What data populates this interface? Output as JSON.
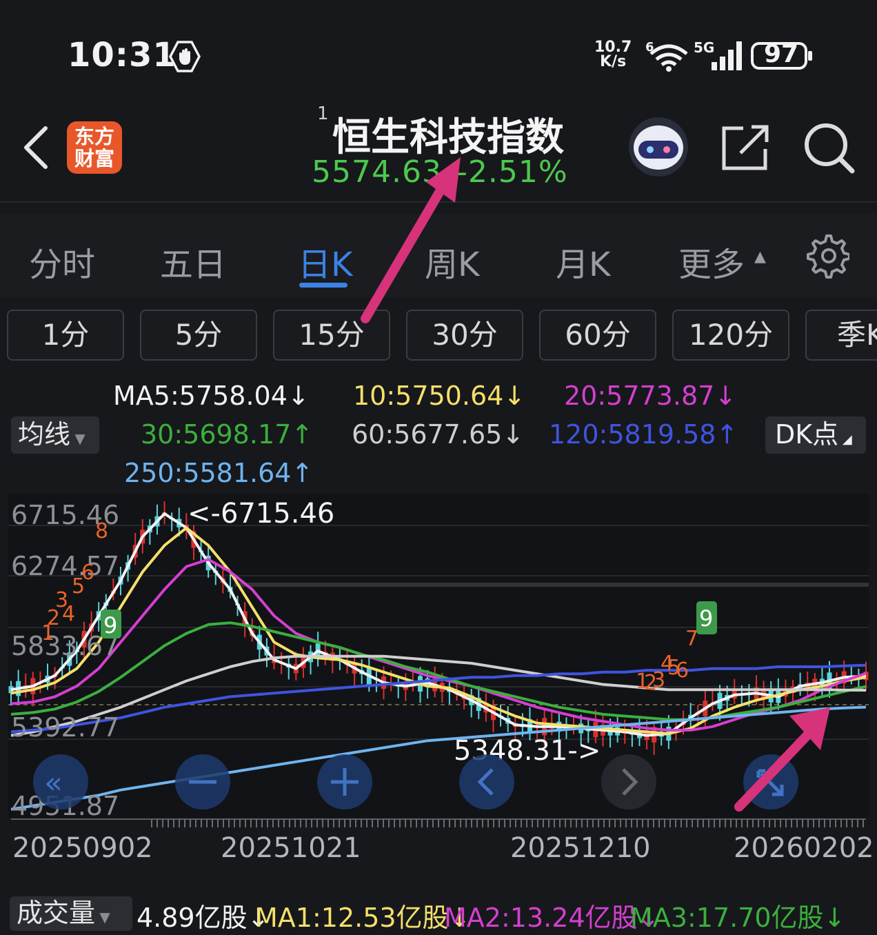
{
  "status_bar": {
    "time": "10:31",
    "net_speed_value": "10.7",
    "net_speed_unit": "K/s",
    "wifi_badge": "6",
    "signal_label": "5G",
    "battery": "97"
  },
  "header": {
    "logo_text_line1": "东方",
    "logo_text_line2": "财富",
    "title_sup": "1",
    "title": "恒生科技指数",
    "price": "5574.63",
    "change": "-2.51%"
  },
  "tabs": [
    {
      "label": "分时",
      "active": false
    },
    {
      "label": "五日",
      "active": false
    },
    {
      "label": "日K",
      "active": true
    },
    {
      "label": "周K",
      "active": false
    },
    {
      "label": "月K",
      "active": false
    },
    {
      "label": "更多",
      "active": false
    }
  ],
  "intervals": [
    "1分",
    "5分",
    "15分",
    "30分",
    "60分",
    "120分",
    "季K"
  ],
  "ma_select": "均线",
  "dk_button": "DK点",
  "ma_legend": [
    {
      "text": "MA5:5758.04↓",
      "color": "#f2f2f2"
    },
    {
      "text": "10:5750.64↓",
      "color": "#f5e06a"
    },
    {
      "text": "20:5773.87↓",
      "color": "#d43fd0"
    },
    {
      "text": "30:5698.17↑",
      "color": "#3bb03d"
    },
    {
      "text": "60:5677.65↓",
      "color": "#cfcfcf"
    },
    {
      "text": "120:5819.58↑",
      "color": "#3f54e0"
    },
    {
      "text": "250:5581.64↑",
      "color": "#6fb4f0"
    }
  ],
  "chart_data": {
    "type": "candlestick",
    "y_ticks": [
      "6715.46",
      "6274.57",
      "5833.67",
      "5392.77",
      "4951.87"
    ],
    "ylim": [
      4951.87,
      6715.46
    ],
    "x_ticks": [
      "20250902",
      "20251021",
      "20251210",
      "20260202"
    ],
    "annotations": {
      "high": "<-6715.46",
      "low": "5348.31->"
    },
    "dk_marks_left": [
      "1",
      "2",
      "3",
      "4",
      "5",
      "6",
      "8"
    ],
    "dk_marks_right": [
      "1",
      "2",
      "3",
      "4",
      "5",
      "6",
      "7"
    ],
    "signal_badges": [
      "9",
      "9"
    ],
    "current_price": 5574.63,
    "series": [
      {
        "name": "MA5",
        "color": "#f2f2f2",
        "values": [
          5680,
          5700,
          5760,
          5900,
          6100,
          6300,
          6550,
          6680,
          6600,
          6400,
          6250,
          6000,
          5850,
          5800,
          5900,
          5850,
          5780,
          5720,
          5700,
          5720,
          5680,
          5620,
          5550,
          5480,
          5470,
          5470,
          5460,
          5450,
          5440,
          5420,
          5430,
          5520,
          5600,
          5650,
          5660,
          5640,
          5700,
          5720,
          5750,
          5758
        ]
      },
      {
        "name": "10",
        "color": "#f5e06a",
        "values": [
          5660,
          5680,
          5720,
          5800,
          5950,
          6150,
          6350,
          6500,
          6600,
          6500,
          6350,
          6150,
          5950,
          5880,
          5860,
          5850,
          5820,
          5780,
          5740,
          5700,
          5690,
          5640,
          5580,
          5530,
          5490,
          5480,
          5470,
          5460,
          5450,
          5440,
          5430,
          5460,
          5530,
          5580,
          5620,
          5650,
          5680,
          5700,
          5730,
          5750
        ]
      },
      {
        "name": "20",
        "color": "#d43fd0",
        "values": [
          5600,
          5610,
          5640,
          5700,
          5800,
          5950,
          6100,
          6250,
          6380,
          6420,
          6350,
          6250,
          6100,
          6000,
          5950,
          5920,
          5880,
          5840,
          5800,
          5760,
          5730,
          5700,
          5660,
          5620,
          5580,
          5550,
          5520,
          5500,
          5480,
          5460,
          5450,
          5450,
          5470,
          5510,
          5550,
          5580,
          5620,
          5680,
          5730,
          5773
        ]
      },
      {
        "name": "30",
        "color": "#3bb03d",
        "values": [
          5540,
          5550,
          5570,
          5610,
          5670,
          5750,
          5840,
          5930,
          6000,
          6050,
          6060,
          6040,
          6010,
          5980,
          5950,
          5920,
          5880,
          5850,
          5810,
          5780,
          5740,
          5700,
          5670,
          5640,
          5610,
          5580,
          5560,
          5540,
          5530,
          5520,
          5510,
          5510,
          5520,
          5540,
          5560,
          5580,
          5610,
          5640,
          5670,
          5698
        ]
      },
      {
        "name": "60",
        "color": "#cfcfcf",
        "values": [
          5420,
          5440,
          5470,
          5500,
          5540,
          5580,
          5630,
          5680,
          5730,
          5770,
          5810,
          5840,
          5860,
          5870,
          5870,
          5870,
          5870,
          5870,
          5860,
          5850,
          5840,
          5830,
          5810,
          5790,
          5770,
          5750,
          5730,
          5710,
          5700,
          5690,
          5680,
          5680,
          5680,
          5680,
          5680,
          5680,
          5680,
          5680,
          5678,
          5677
        ]
      },
      {
        "name": "120",
        "color": "#3f54e0",
        "values": [
          5440,
          5450,
          5460,
          5480,
          5500,
          5520,
          5550,
          5580,
          5600,
          5620,
          5640,
          5650,
          5660,
          5670,
          5680,
          5690,
          5700,
          5710,
          5720,
          5730,
          5740,
          5750,
          5750,
          5760,
          5760,
          5770,
          5770,
          5780,
          5780,
          5790,
          5790,
          5790,
          5800,
          5800,
          5800,
          5810,
          5810,
          5810,
          5815,
          5819
        ]
      },
      {
        "name": "250",
        "color": "#6fb4f0",
        "values": [
          5000,
          5020,
          5040,
          5060,
          5080,
          5110,
          5130,
          5150,
          5170,
          5190,
          5210,
          5230,
          5250,
          5270,
          5290,
          5310,
          5330,
          5350,
          5370,
          5390,
          5400,
          5410,
          5420,
          5430,
          5440,
          5450,
          5460,
          5470,
          5480,
          5490,
          5500,
          5510,
          5520,
          5530,
          5540,
          5550,
          5560,
          5570,
          5576,
          5581
        ]
      }
    ]
  },
  "chart_controls": [
    "jump-start",
    "zoom-out",
    "zoom-in",
    "prev",
    "next",
    "jump-end"
  ],
  "volume": {
    "select": "成交量",
    "value": "4.89亿股↓",
    "ma1": "MA1:12.53亿股↓",
    "ma2": "MA2:13.24亿股↓",
    "ma3": "MA3:17.70亿股↓",
    "colors": {
      "value": "#f2f2f2",
      "ma1": "#f5e06a",
      "ma2": "#d43fd0",
      "ma3": "#3bb03d"
    }
  }
}
